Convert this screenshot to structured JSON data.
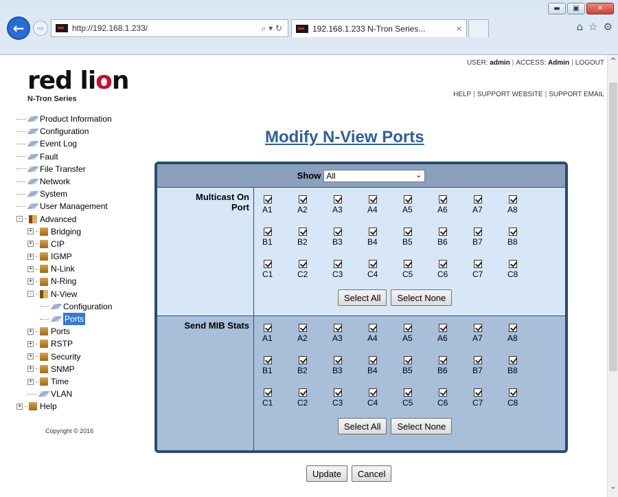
{
  "browser": {
    "url": "http://192.168.1.233/",
    "tab_title": "192.168.1.233 N-Tron Series...",
    "forward_glyph": "⇨",
    "back_glyph": "🡐",
    "address_tools": "⌕ ▾ ↻",
    "window_controls": [
      "▬",
      "▣",
      "✕"
    ],
    "toolbar_icons": [
      "⌂",
      "☆",
      "⚙"
    ],
    "tab_close": "×"
  },
  "header": {
    "logo_text_left": "red li",
    "logo_text_o": "o",
    "logo_text_right": "n",
    "logo_sub": "N-Tron Series",
    "user_label": "USER:",
    "user_value": "admin",
    "access_label": "ACCESS:",
    "access_value": "Admin",
    "logout": "LOGOUT",
    "help": "HELP",
    "support_website": "SUPPORT WEBSITE",
    "support_email": "SUPPORT EMAIL"
  },
  "tree": {
    "items": [
      {
        "label": "Product Information",
        "kind": "doc",
        "level": 0
      },
      {
        "label": "Configuration",
        "kind": "doc",
        "level": 0
      },
      {
        "label": "Event Log",
        "kind": "doc",
        "level": 0
      },
      {
        "label": "Fault",
        "kind": "doc",
        "level": 0
      },
      {
        "label": "File Transfer",
        "kind": "doc",
        "level": 0
      },
      {
        "label": "Network",
        "kind": "doc",
        "level": 0
      },
      {
        "label": "System",
        "kind": "doc",
        "level": 0
      },
      {
        "label": "User Management",
        "kind": "doc",
        "level": 0
      },
      {
        "label": "Advanced",
        "kind": "folder-open",
        "level": 0
      },
      {
        "label": "Bridging",
        "kind": "folder",
        "level": 1
      },
      {
        "label": "CIP",
        "kind": "folder",
        "level": 1
      },
      {
        "label": "IGMP",
        "kind": "folder",
        "level": 1
      },
      {
        "label": "N-Link",
        "kind": "folder",
        "level": 1
      },
      {
        "label": "N-Ring",
        "kind": "folder",
        "level": 1
      },
      {
        "label": "N-View",
        "kind": "folder-open",
        "level": 1
      },
      {
        "label": "Configuration",
        "kind": "doc",
        "level": 2
      },
      {
        "label": "Ports",
        "kind": "doc",
        "level": 2,
        "selected": true
      },
      {
        "label": "Ports",
        "kind": "folder",
        "level": 1
      },
      {
        "label": "RSTP",
        "kind": "folder",
        "level": 1
      },
      {
        "label": "Security",
        "kind": "folder",
        "level": 1
      },
      {
        "label": "SNMP",
        "kind": "folder",
        "level": 1
      },
      {
        "label": "Time",
        "kind": "folder",
        "level": 1
      },
      {
        "label": "VLAN",
        "kind": "doc",
        "level": 1
      },
      {
        "label": "Help",
        "kind": "folder",
        "level": 0
      }
    ],
    "copyright": "Copyright © 2016"
  },
  "main": {
    "title": "Modify N-View Ports",
    "show_label": "Show",
    "show_value": "All",
    "sections": [
      {
        "label_line1": "Multicast On",
        "label_line2": "Port"
      },
      {
        "label_line1": "Send MIB Stats",
        "label_line2": ""
      }
    ],
    "port_rows": [
      [
        "A1",
        "A2",
        "A3",
        "A4",
        "A5",
        "A6",
        "A7",
        "A8"
      ],
      [
        "B1",
        "B2",
        "B3",
        "B4",
        "B5",
        "B6",
        "B7",
        "B8"
      ],
      [
        "C1",
        "C2",
        "C3",
        "C4",
        "C5",
        "C6",
        "C7",
        "C8"
      ]
    ],
    "all_checked": true,
    "select_all": "Select All",
    "select_none": "Select None",
    "update": "Update",
    "cancel": "Cancel"
  }
}
